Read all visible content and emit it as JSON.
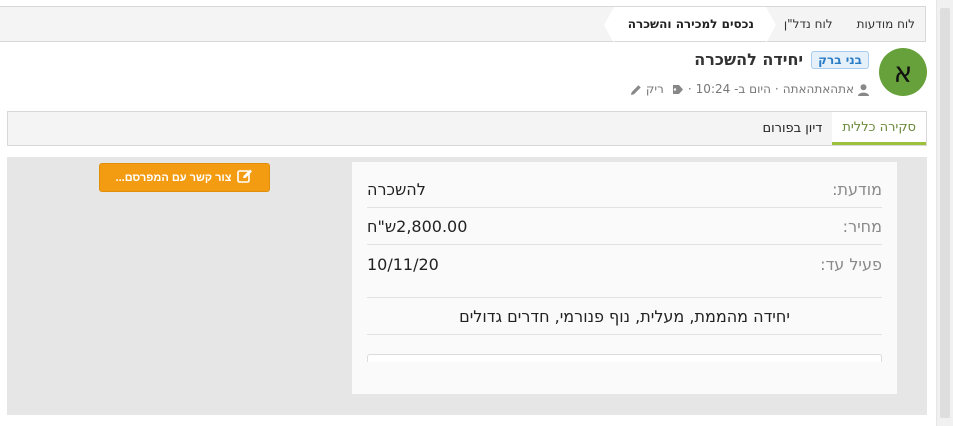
{
  "breadcrumb": [
    {
      "label": "לוח מודעות"
    },
    {
      "label": "לוח נדל\"ן"
    },
    {
      "label": "נכסים למכירה והשכרה"
    }
  ],
  "avatar": {
    "letter": "א",
    "color": "#66a13b"
  },
  "thread": {
    "prefix": "בני ברק",
    "title": "יחידה להשכרה",
    "author": "אתהאתהאתה",
    "time": "היום ב- 10:24",
    "tags": "ריק"
  },
  "tabs": [
    {
      "label": "סקירה כללית",
      "active": true
    },
    {
      "label": "דיון בפורום",
      "active": false
    }
  ],
  "contact_button": {
    "label": "צור קשר עם המפרסם..."
  },
  "fields": [
    {
      "label": "מודעת:",
      "value": "להשכרה"
    },
    {
      "label": "מחיר:",
      "value": "2,800.00ש\"ח"
    },
    {
      "label": "פעיל עד:",
      "value": "10/11/20"
    }
  ],
  "description": "יחידה מהממת, מעלית, נוף פנורמי, חדרים גדולים",
  "colors": {
    "accent": "#9cc13a",
    "button": "#f39c12",
    "badge": "#2a7cc7"
  }
}
